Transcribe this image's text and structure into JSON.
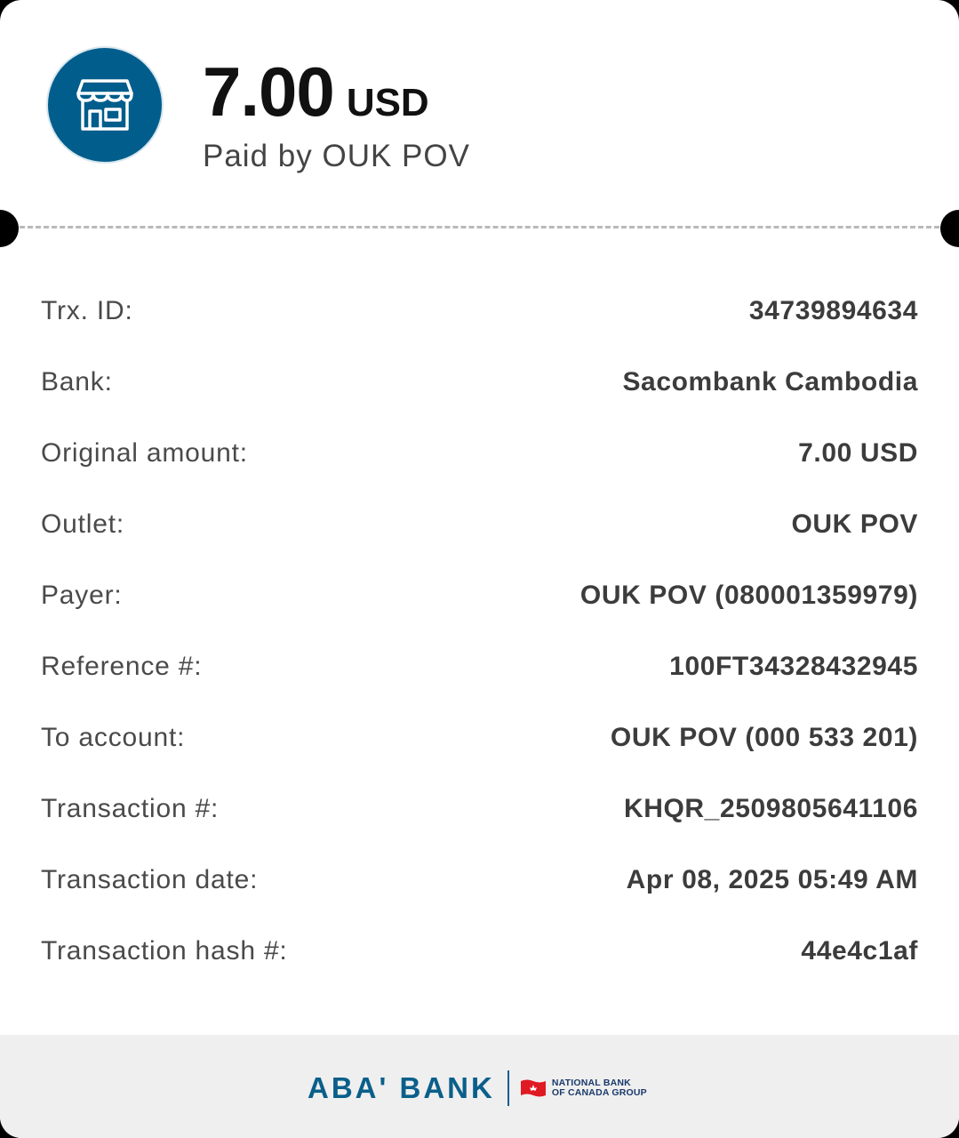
{
  "header": {
    "amount": "7.00",
    "currency": "USD",
    "paid_by": "Paid by OUK POV",
    "icon": "store-icon"
  },
  "details": [
    {
      "label": "Trx. ID:",
      "value": "34739894634"
    },
    {
      "label": "Bank:",
      "value": "Sacombank Cambodia"
    },
    {
      "label": "Original amount:",
      "value": "7.00 USD"
    },
    {
      "label": "Outlet:",
      "value": "OUK POV"
    },
    {
      "label": "Payer:",
      "value": "OUK POV (080001359979)"
    },
    {
      "label": "Reference #:",
      "value": "100FT34328432945"
    },
    {
      "label": "To account:",
      "value": "OUK POV (000 533 201)"
    },
    {
      "label": "Transaction #:",
      "value": "KHQR_2509805641106"
    },
    {
      "label": "Transaction date:",
      "value": "Apr 08, 2025 05:49 AM"
    },
    {
      "label": "Transaction hash #:",
      "value": "44e4c1af"
    }
  ],
  "footer": {
    "brand": "ABA' BANK",
    "partner_line1": "NATIONAL BANK",
    "partner_line2": "OF CANADA GROUP"
  },
  "colors": {
    "brand_blue": "#005d8c",
    "partner_red": "#e01a22"
  }
}
